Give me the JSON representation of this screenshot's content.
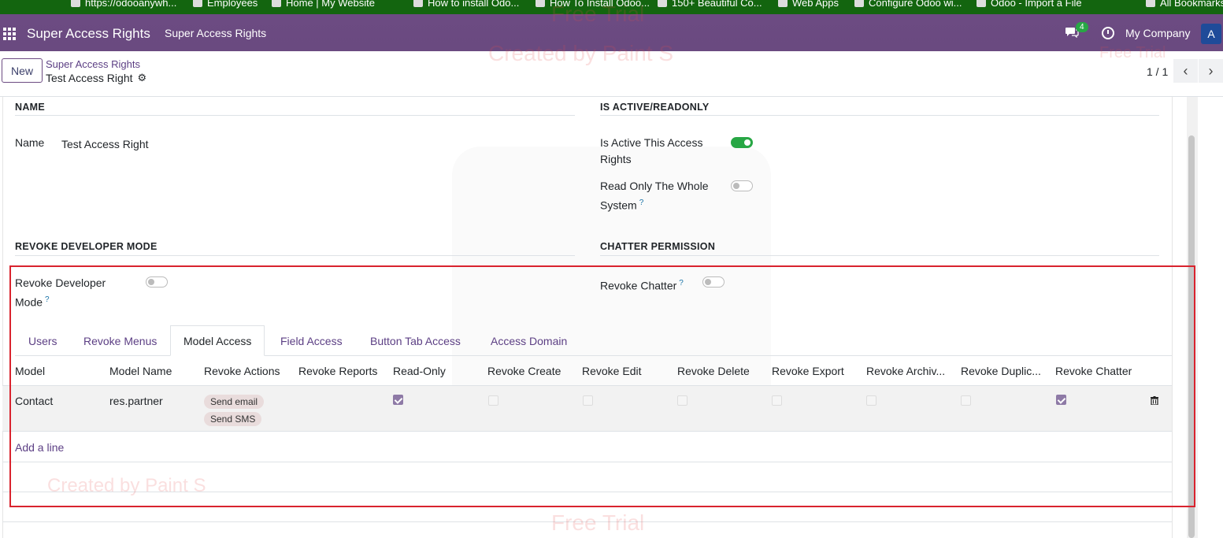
{
  "bookmarks": [
    "https://odooanywh...",
    "Employees",
    "Home | My Website",
    "How to install Odo...",
    "How To Install Odoo...",
    "150+ Beautiful Co...",
    "Web Apps",
    "Configure Odoo wi...",
    "Odoo - Import a File",
    "All Bookmarks"
  ],
  "navbar": {
    "brand": "Super Access Rights",
    "menu": "Super Access Rights",
    "message_count": "4",
    "company": "My Company",
    "avatar_letter": "A"
  },
  "control": {
    "new_label": "New",
    "breadcrumb_parent": "Super Access Rights",
    "breadcrumb_current": "Test Access Right",
    "pager": "1 / 1"
  },
  "form": {
    "name_section": "NAME",
    "name_label": "Name",
    "name_value": "Test Access Right",
    "active_section": "IS ACTIVE/READONLY",
    "is_active_label": "Is Active This Access Rights",
    "is_active_value": true,
    "readonly_label": "Read Only The Whole System",
    "readonly_value": false,
    "devmode_section": "REVOKE DEVELOPER MODE",
    "devmode_label": "Revoke Developer Mode",
    "devmode_value": false,
    "chatter_section": "CHATTER PERMISSION",
    "chatter_label": "Revoke Chatter",
    "chatter_value": false,
    "help_mark": "?"
  },
  "tabs": [
    "Users",
    "Revoke Menus",
    "Model Access",
    "Field Access",
    "Button Tab Access",
    "Access Domain"
  ],
  "active_tab": "Model Access",
  "table": {
    "columns": [
      "Model",
      "Model Name",
      "Revoke Actions",
      "Revoke Reports",
      "Read-Only",
      "Revoke Create",
      "Revoke Edit",
      "Revoke Delete",
      "Revoke Export",
      "Revoke Archiv...",
      "Revoke Duplic...",
      "Revoke Chatter"
    ],
    "rows": [
      {
        "model": "Contact",
        "model_name": "res.partner",
        "revoke_actions": [
          "Send email",
          "Send SMS"
        ],
        "read_only": true,
        "revoke_create": false,
        "revoke_edit": false,
        "revoke_delete": false,
        "revoke_export": false,
        "revoke_archive": false,
        "revoke_duplicate": false,
        "revoke_chatter": true
      }
    ],
    "add_line": "Add a line"
  },
  "watermarks": [
    "Free Trial",
    "Created by Paint S",
    "Free Trial",
    "Created by Paint S",
    "Free Trial"
  ],
  "colors": {
    "navbar": "#6a4a80",
    "toggle_on": "#28a745",
    "link": "#5c3f84",
    "highlight": "#d9232e"
  }
}
